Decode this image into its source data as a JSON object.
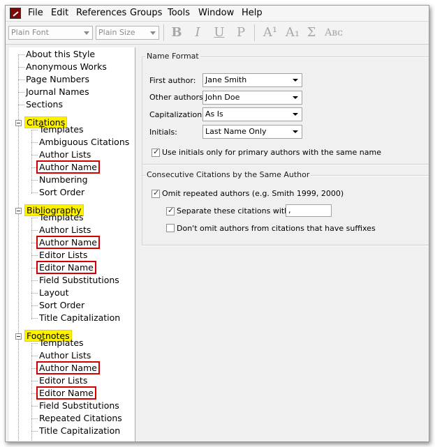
{
  "menu": [
    "File",
    "Edit",
    "References",
    "Groups",
    "Tools",
    "Window",
    "Help"
  ],
  "toolbar": {
    "font_value": "Plain Font",
    "size_value": "Plain Size",
    "bold": "B",
    "italic": "I",
    "underline": "U",
    "plain": "P",
    "superscript": "A¹",
    "subscript": "A₁",
    "symbol": "Σ",
    "smallcaps": "Aʙᴄ"
  },
  "tree": {
    "root_items": [
      "About this Style",
      "Anonymous Works",
      "Page Numbers",
      "Journal Names",
      "Sections"
    ],
    "citations": {
      "label": "Citations",
      "children": [
        "Templates",
        "Ambiguous Citations",
        "Author Lists",
        "Author Name",
        "Numbering",
        "Sort Order"
      ]
    },
    "bibliography": {
      "label": "Bibliography",
      "children": [
        "Templates",
        "Author Lists",
        "Author Name",
        "Editor Lists",
        "Editor Name",
        "Field Substitutions",
        "Layout",
        "Sort Order",
        "Title Capitalization"
      ]
    },
    "footnotes": {
      "label": "Footnotes",
      "children": [
        "Templates",
        "Author Lists",
        "Author Name",
        "Editor Lists",
        "Editor Name",
        "Field Substitutions",
        "Repeated Citations",
        "Title Capitalization"
      ]
    }
  },
  "name_format": {
    "title": "Name Format",
    "first_author_label": "First author:",
    "first_author_value": "Jane Smith",
    "other_authors_label": "Other authors:",
    "other_authors_value": "John Doe",
    "capitalization_label": "Capitalization:",
    "capitalization_value": "As Is",
    "initials_label": "Initials:",
    "initials_value": "Last Name Only",
    "use_initials_label": "Use initials only for primary authors with the same name"
  },
  "consecutive": {
    "title": "Consecutive Citations by the Same Author",
    "omit_label": "Omit repeated authors (e.g. Smith 1999, 2000)",
    "separate_label": "Separate these citations with:",
    "separator_value": ",",
    "dont_omit_label": "Don't omit authors from citations that have suffixes"
  },
  "colors": {
    "highlight": "#fff200",
    "red_box": "#d40000"
  }
}
